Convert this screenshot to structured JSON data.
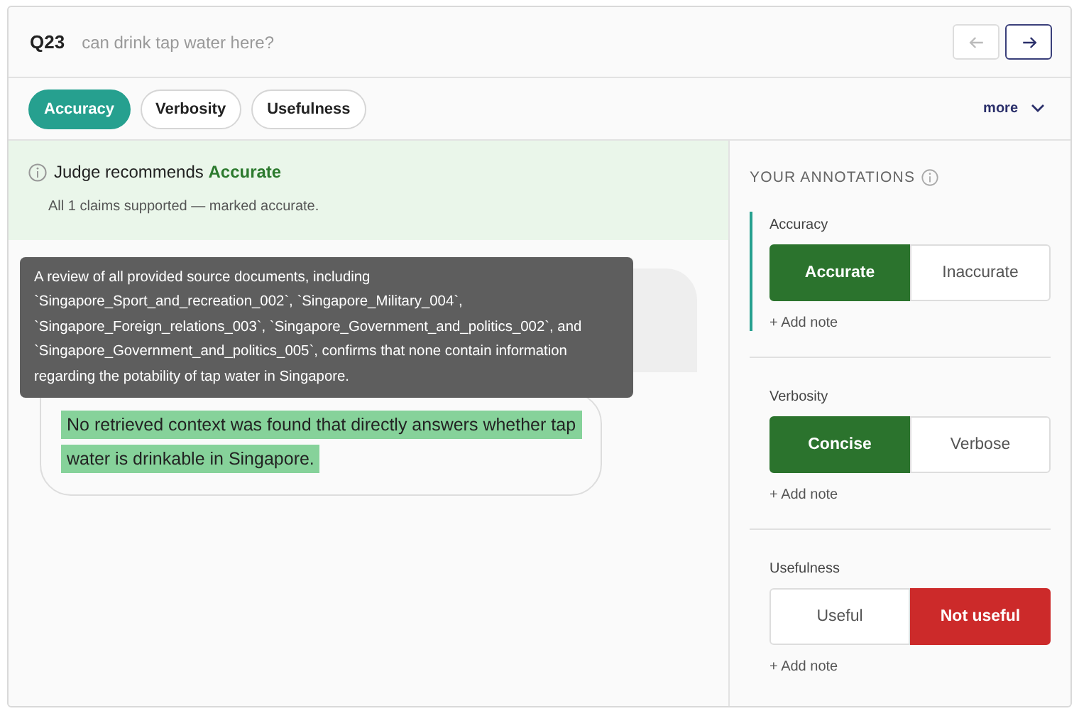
{
  "question": {
    "number": "Q23",
    "text": "can drink tap water here?"
  },
  "nav": [
    {
      "kind": "prev",
      "disabled": true
    },
    {
      "kind": "next",
      "disabled": false
    }
  ],
  "tabs": [
    {
      "label": "Accuracy",
      "selected": true
    },
    {
      "label": "Verbosity",
      "selected": false
    },
    {
      "label": "Usefulness",
      "selected": false
    }
  ],
  "more": "more",
  "judge": {
    "prefix": "Judge recommends",
    "verdict": "Accurate",
    "note": "All 1 claims supported — marked accurate."
  },
  "tooltip": "A review of all provided source documents, including `Singapore_Sport_and_recreation_002`, `Singapore_Military_004`, `Singapore_Foreign_relations_003`, `Singapore_Government_and_politics_002`, and `Singapore_Government_and_politics_005`, confirms that none contain information regarding the potability of tap water in Singapore.",
  "answer": {
    "text": "No retrieved context was found that directly answers whether tap water is drinkable in Singapore.",
    "highlighted": true
  },
  "annotations": {
    "title": "YOUR ANNOTATIONS",
    "groups": [
      {
        "label": "Accuracy",
        "options": [
          {
            "label": "Accurate",
            "selected": true,
            "kind": "positive"
          },
          {
            "label": "Inaccurate",
            "selected": false,
            "kind": "negative"
          }
        ],
        "note": "+ Add note"
      },
      {
        "label": "Verbosity",
        "options": [
          {
            "label": "Concise",
            "selected": true,
            "kind": "positive"
          },
          {
            "label": "Verbose",
            "selected": false,
            "kind": "negative"
          }
        ],
        "note": "+ Add note"
      },
      {
        "label": "Usefulness",
        "options": [
          {
            "label": "Useful",
            "selected": false,
            "kind": "positive"
          },
          {
            "label": "Not useful",
            "selected": true,
            "kind": "negative"
          }
        ],
        "note": "+ Add note"
      }
    ]
  }
}
